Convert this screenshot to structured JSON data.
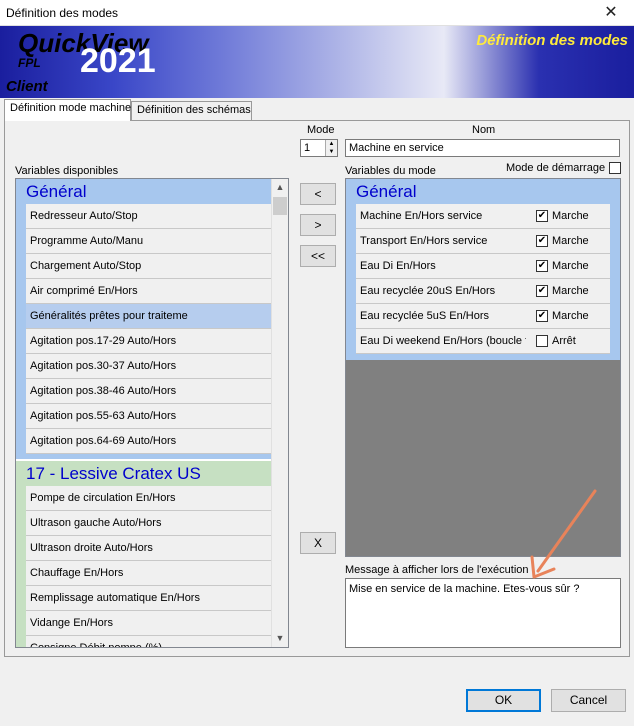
{
  "window": {
    "title": "Définition des modes",
    "close_glyph": "✕"
  },
  "banner": {
    "app_name": "QuickView",
    "year": "2021",
    "fpl": "FPL",
    "client": "Client",
    "heading": "Définition des modes"
  },
  "tabs": [
    {
      "label": "Définition mode machine"
    },
    {
      "label": "Définition des schémas"
    }
  ],
  "labels": {
    "mode": "Mode",
    "nom": "Nom",
    "variables_disponibles": "Variables disponibles",
    "variables_du_mode": "Variables du mode",
    "mode_demarrage": "Mode de démarrage",
    "message": "Message à afficher lors de l'exécution"
  },
  "mode": {
    "value": "1",
    "spin_up": "▲",
    "spin_down": "▼"
  },
  "nom": {
    "value": "Machine en service"
  },
  "mode_demarrage_checked": false,
  "available": {
    "groups": [
      {
        "title": "Général",
        "color": "#a7c7ee",
        "items": [
          {
            "label": "Redresseur Auto/Stop"
          },
          {
            "label": "Programme Auto/Manu"
          },
          {
            "label": "Chargement Auto/Stop"
          },
          {
            "label": "Air comprimé En/Hors"
          },
          {
            "label": "Généralités prêtes pour traiteme",
            "selected": true
          },
          {
            "label": "Agitation pos.17-29 Auto/Hors"
          },
          {
            "label": "Agitation pos.30-37 Auto/Hors"
          },
          {
            "label": "Agitation pos.38-46 Auto/Hors"
          },
          {
            "label": "Agitation pos.55-63 Auto/Hors"
          },
          {
            "label": "Agitation pos.64-69 Auto/Hors"
          }
        ]
      },
      {
        "title": "17 - Lessive Cratex US",
        "color": "#c6e0c2",
        "items": [
          {
            "label": "Pompe de circulation En/Hors"
          },
          {
            "label": "Ultrason gauche Auto/Hors"
          },
          {
            "label": "Ultrason droite Auto/Hors"
          },
          {
            "label": "Chauffage En/Hors"
          },
          {
            "label": "Remplissage automatique En/Hors"
          },
          {
            "label": "Vidange En/Hors"
          },
          {
            "label": "Consigne Débit pompe (%)"
          }
        ]
      }
    ],
    "scroll_up": "▲",
    "scroll_down": "▼"
  },
  "mode_vars": {
    "group_title": "Général",
    "group_color": "#a7c7ee",
    "items": [
      {
        "label": "Machine En/Hors service",
        "checked": true,
        "check_glyph": "✔",
        "state": "Marche"
      },
      {
        "label": "Transport En/Hors service",
        "checked": true,
        "check_glyph": "✔",
        "state": "Marche"
      },
      {
        "label": "Eau Di En/Hors",
        "checked": true,
        "check_glyph": "✔",
        "state": "Marche"
      },
      {
        "label": "Eau recyclée 20uS En/Hors",
        "checked": true,
        "check_glyph": "✔",
        "state": "Marche"
      },
      {
        "label": "Eau recyclée 5uS En/Hors",
        "checked": true,
        "check_glyph": "✔",
        "state": "Marche"
      },
      {
        "label": "Eau Di weekend En/Hors (boucle f",
        "checked": false,
        "check_glyph": "",
        "state": "Arrêt"
      }
    ]
  },
  "buttons": {
    "move_left": "<",
    "move_right": ">",
    "move_all_left": "<<",
    "remove": "X",
    "ok": "OK",
    "cancel": "Cancel"
  },
  "message": {
    "value": "Mise en service de la machine. Etes-vous sûr ?"
  },
  "colors": {
    "annotation_arrow": "#e8835a"
  }
}
